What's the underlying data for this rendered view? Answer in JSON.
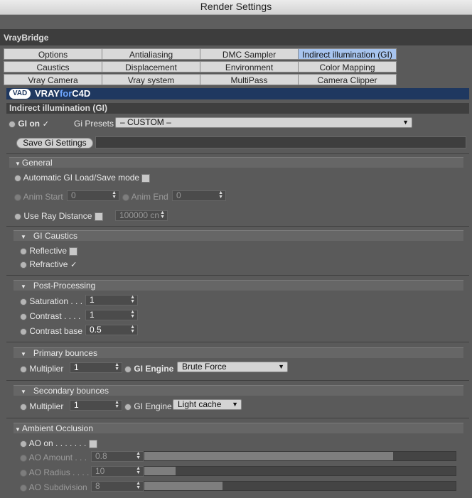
{
  "window": {
    "title": "Render Settings"
  },
  "plugin": {
    "name": "VrayBridge"
  },
  "tabs": [
    {
      "label": "Options"
    },
    {
      "label": "Antialiasing"
    },
    {
      "label": "DMC Sampler"
    },
    {
      "label": "Indirect illumination (GI)"
    },
    {
      "label": "Caustics"
    },
    {
      "label": "Displacement"
    },
    {
      "label": "Environment"
    },
    {
      "label": "Color Mapping"
    },
    {
      "label": "Vray Camera"
    },
    {
      "label": "Vray system"
    },
    {
      "label": "MultiPass"
    },
    {
      "label": "Camera Clipper"
    }
  ],
  "logo": {
    "mark": "VAD",
    "text_a": "VRAY",
    "text_b": "for",
    "text_c": "C4D"
  },
  "section": {
    "title": "Indirect illumination (GI)"
  },
  "gi": {
    "on_label": "GI on",
    "on_checked": "✓",
    "presets_label": "Gi Presets",
    "presets_value": "– CUSTOM –",
    "save_button": "Save Gi Settings"
  },
  "general": {
    "title": "General",
    "auto_label": "Automatic GI Load/Save mode",
    "anim_start_label": "Anim Start",
    "anim_start_value": "0",
    "anim_end_label": "Anim End",
    "anim_end_value": "0",
    "ray_label": "Use Ray Distance",
    "ray_value": "100000 cn"
  },
  "caustics": {
    "title": "GI Caustics",
    "reflective_label": "Reflective",
    "refractive_label": "Refractive",
    "refractive_checked": "✓"
  },
  "post": {
    "title": "Post-Processing",
    "saturation_label": "Saturation . . .",
    "saturation_value": "1",
    "contrast_label": "Contrast  . . . .",
    "contrast_value": "1",
    "contrast_base_label": "Contrast base",
    "contrast_base_value": "0.5"
  },
  "primary": {
    "title": "Primary bounces",
    "multiplier_label": "Multiplier",
    "multiplier_value": "1",
    "engine_label": "GI Engine",
    "engine_value": "Brute Force"
  },
  "secondary": {
    "title": "Secondary bounces",
    "multiplier_label": "Multiplier",
    "multiplier_value": "1",
    "engine_label": "GI Engine",
    "engine_value": "Light cache"
  },
  "ao": {
    "title": "Ambient Occlusion",
    "on_label": "AO on  . . . . . . .",
    "amount_label": "AO Amount . . .",
    "amount_value": "0.8",
    "amount_fill": 0.8,
    "radius_label": "AO Radius . . . .",
    "radius_value": "10",
    "radius_fill": 0.1,
    "subdivision_label": "AO Subdivision",
    "subdivision_value": "8",
    "subdivision_fill": 0.25
  }
}
